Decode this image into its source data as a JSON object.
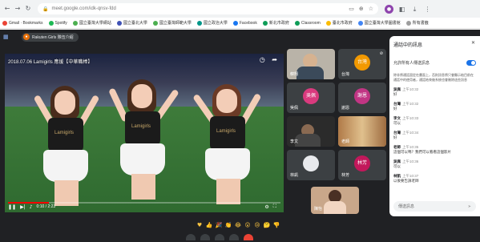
{
  "browser": {
    "url": "meet.google.com/idk-qnsv-fdd",
    "bookmarks": [
      {
        "label": "Gmail · Bookmarks",
        "color": "#ea4335"
      },
      {
        "label": "Spotify",
        "color": "#1db954"
      },
      {
        "label": "國立臺灣大學網站",
        "color": "#4caf50"
      },
      {
        "label": "國立臺北大學",
        "color": "#3f51b5"
      },
      {
        "label": "國立臺灣師範大學",
        "color": "#4caf50"
      },
      {
        "label": "國立政治大學",
        "color": "#009688"
      },
      {
        "label": "Facebook",
        "color": "#1877f2"
      },
      {
        "label": "新北市政府",
        "color": "#0f9d58"
      },
      {
        "label": "Classroom",
        "color": "#0f9d58"
      },
      {
        "label": "臺北市政府",
        "color": "#fbbc04"
      },
      {
        "label": "國立臺灣大學圖書館",
        "color": "#4285f4"
      },
      {
        "label": "所有書籤",
        "color": "#9e9e9e"
      }
    ]
  },
  "meet": {
    "meeting_chip": "Rakuten Girls 隊伍介紹",
    "video_title": "2018.07.06 Lamigirls 應援【中華職棒】",
    "video_time": "0:10 / 2:23",
    "video_progress_pct": 15,
    "tiles": [
      {
        "name": "韓翔",
        "avatar": ""
      },
      {
        "name": "台灣",
        "avatar": "台灣"
      },
      {
        "name": "吳佩",
        "avatar": "吳佩"
      },
      {
        "name": "謝恩",
        "avatar": "謝恩"
      },
      {
        "name": "李文",
        "avatar": ""
      },
      {
        "name": "老師",
        "avatar": ""
      },
      {
        "name": "林凱",
        "avatar": ""
      },
      {
        "name": "林芳",
        "avatar": "林芳"
      },
      {
        "name": "陳怡",
        "avatar": ""
      }
    ],
    "reactions": [
      "♥",
      "👍",
      "🎉",
      "👏",
      "😂",
      "😮",
      "😢",
      "🤔",
      "👎"
    ]
  },
  "chat": {
    "title": "通話中的訊息",
    "toggle_label": "允許所有人傳送訊息",
    "notice": "除非將通話固定在畫面上，否則訊息將只會顯示給目前在通話中的使用者，通話結束後系統也會刪除這些訊息",
    "messages": [
      {
        "sender": "吳佩",
        "time": "上午10:32",
        "text": "好"
      },
      {
        "sender": "台灣",
        "time": "上午10:32",
        "text": "好"
      },
      {
        "sender": "李文",
        "time": "上午10:33",
        "text": "可以"
      },
      {
        "sender": "台灣",
        "time": "上午10:34",
        "text": "好"
      },
      {
        "sender": "老師",
        "time": "上午10:35",
        "text": "這個可以嗎？我們可以看看這個影片"
      },
      {
        "sender": "吳佩",
        "time": "上午10:36",
        "text": "可以"
      },
      {
        "sender": "林凱",
        "time": "上午10:37",
        "text": "以後要告訴老師"
      }
    ],
    "input_placeholder": "傳送訊息"
  }
}
